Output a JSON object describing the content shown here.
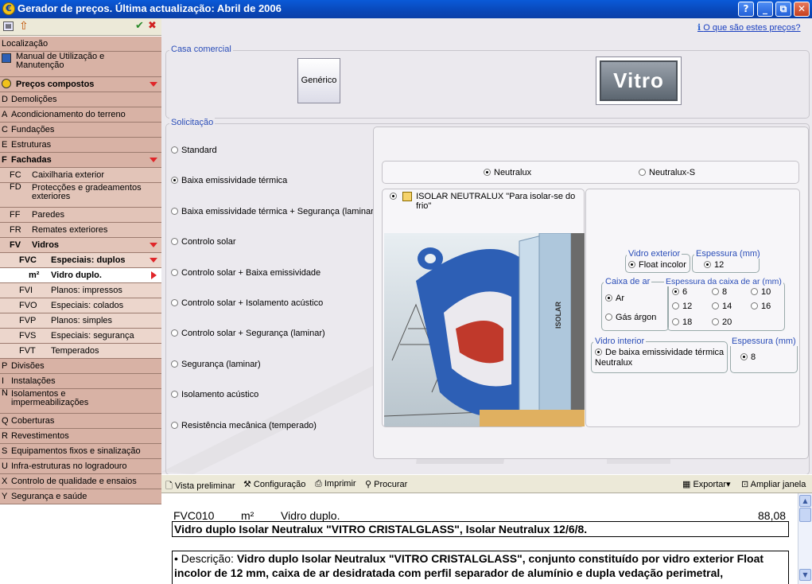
{
  "window": {
    "title": "Gerador de preços. Última actualização: Abril de 2006",
    "buttons": [
      "?",
      "_",
      "⧉",
      "✕"
    ]
  },
  "sidebar": {
    "items": [
      {
        "code": "",
        "label": "Localização",
        "level": 0
      },
      {
        "code": "",
        "label": "Manual de Utilização e Manutenção",
        "level": 0
      },
      {
        "code": "",
        "label": "Preços compostos",
        "level": 0
      },
      {
        "code": "D",
        "label": "Demolições",
        "level": 1
      },
      {
        "code": "A",
        "label": "Acondicionamento do terreno",
        "level": 1
      },
      {
        "code": "C",
        "label": "Fundações",
        "level": 1
      },
      {
        "code": "E",
        "label": "Estruturas",
        "level": 1
      },
      {
        "code": "F",
        "label": "Fachadas",
        "level": 1
      },
      {
        "code": "FC",
        "label": "Caixilharia exterior",
        "level": 2
      },
      {
        "code": "FD",
        "label": "Protecções e gradeamentos exteriores",
        "level": 2
      },
      {
        "code": "FF",
        "label": "Paredes",
        "level": 2
      },
      {
        "code": "FR",
        "label": "Remates exteriores",
        "level": 2
      },
      {
        "code": "FV",
        "label": "Vidros",
        "level": 2
      },
      {
        "code": "FVC",
        "label": "Especiais: duplos",
        "level": 3
      },
      {
        "code": "m²",
        "label": "Vidro duplo.",
        "level": 4
      },
      {
        "code": "FVI",
        "label": "Planos: impressos",
        "level": 3
      },
      {
        "code": "FVO",
        "label": "Especiais: colados",
        "level": 3
      },
      {
        "code": "FVP",
        "label": "Planos: simples",
        "level": 3
      },
      {
        "code": "FVS",
        "label": "Especiais: segurança",
        "level": 3
      },
      {
        "code": "FVT",
        "label": "Temperados",
        "level": 3
      },
      {
        "code": "P",
        "label": "Divisões",
        "level": 1
      },
      {
        "code": "I",
        "label": "Instalações",
        "level": 1
      },
      {
        "code": "N",
        "label": "Isolamentos e impermeabilizações",
        "level": 1
      },
      {
        "code": "Q",
        "label": "Coberturas",
        "level": 1
      },
      {
        "code": "R",
        "label": "Revestimentos",
        "level": 1
      },
      {
        "code": "S",
        "label": "Equipamentos fixos e sinalização",
        "level": 1
      },
      {
        "code": "U",
        "label": "Infra-estruturas no logradouro",
        "level": 1
      },
      {
        "code": "X",
        "label": "Controlo de qualidade e ensaios",
        "level": 1
      },
      {
        "code": "Y",
        "label": "Segurança e saúde",
        "level": 1
      }
    ]
  },
  "help_link": "O que são estes preços?",
  "casa": {
    "legend": "Casa comercial",
    "generic": "Genérico",
    "brand": "Vitro"
  },
  "solicitacao": {
    "legend": "Solicitação",
    "options": [
      "Standard",
      "Baixa emissividade térmica",
      "Baixa emissividade térmica + Segurança (laminar)",
      "Controlo solar",
      "Controlo solar + Baixa emissividade",
      "Controlo solar + Isolamento acústico",
      "Controlo solar + Segurança (laminar)",
      "Segurança (laminar)",
      "Isolamento acústico",
      "Resistência mecânica (temperado)"
    ],
    "selected": 1
  },
  "variant": {
    "options": [
      "Neutralux",
      "Neutralux-S"
    ],
    "selected": 0
  },
  "product": {
    "label": "ISOLAR NEUTRALUX \"Para isolar-se do frio\"",
    "image_text": "ISOLAR"
  },
  "config": {
    "vidro_exterior": {
      "legend": "Vidro exterior",
      "value": "Float incolor"
    },
    "espessura_ext": {
      "legend": "Espessura (mm)",
      "value": "12"
    },
    "caixa_ar": {
      "legend": "Caixa de ar",
      "options": [
        "Ar",
        "Gás árgon"
      ],
      "selected": 0
    },
    "esp_caixa": {
      "legend": "Espessura da caixa de ar (mm)",
      "options": [
        "6",
        "8",
        "10",
        "12",
        "14",
        "16",
        "18",
        "20"
      ],
      "selected": 0
    },
    "vidro_interior": {
      "legend": "Vidro interior",
      "value": "De baixa emissividade térmica Neutralux"
    },
    "espessura_int": {
      "legend": "Espessura (mm)",
      "value": "8"
    }
  },
  "toolbar": {
    "preview": "Vista preliminar",
    "config": "Configuração",
    "print": "Imprimir",
    "search": "Procurar",
    "export": "Exportar",
    "expand": "Ampliar janela"
  },
  "price": {
    "code": "FVC010",
    "unit": "m²",
    "short": "Vidro duplo.",
    "value": "88,08",
    "title": "Vidro duplo Isolar Neutralux \"VITRO CRISTALGLASS\", Isolar Neutralux 12/6/8.",
    "desc_prefix": "• Descrição: ",
    "desc_bold": "Vidro duplo Isolar Neutralux \"VITRO CRISTALGLASS\", conjunto constituído por vidro exterior Float incolor de 12 mm, caixa de ar desidratada com perfil separador de alumínio e dupla vedação perimetral,"
  }
}
